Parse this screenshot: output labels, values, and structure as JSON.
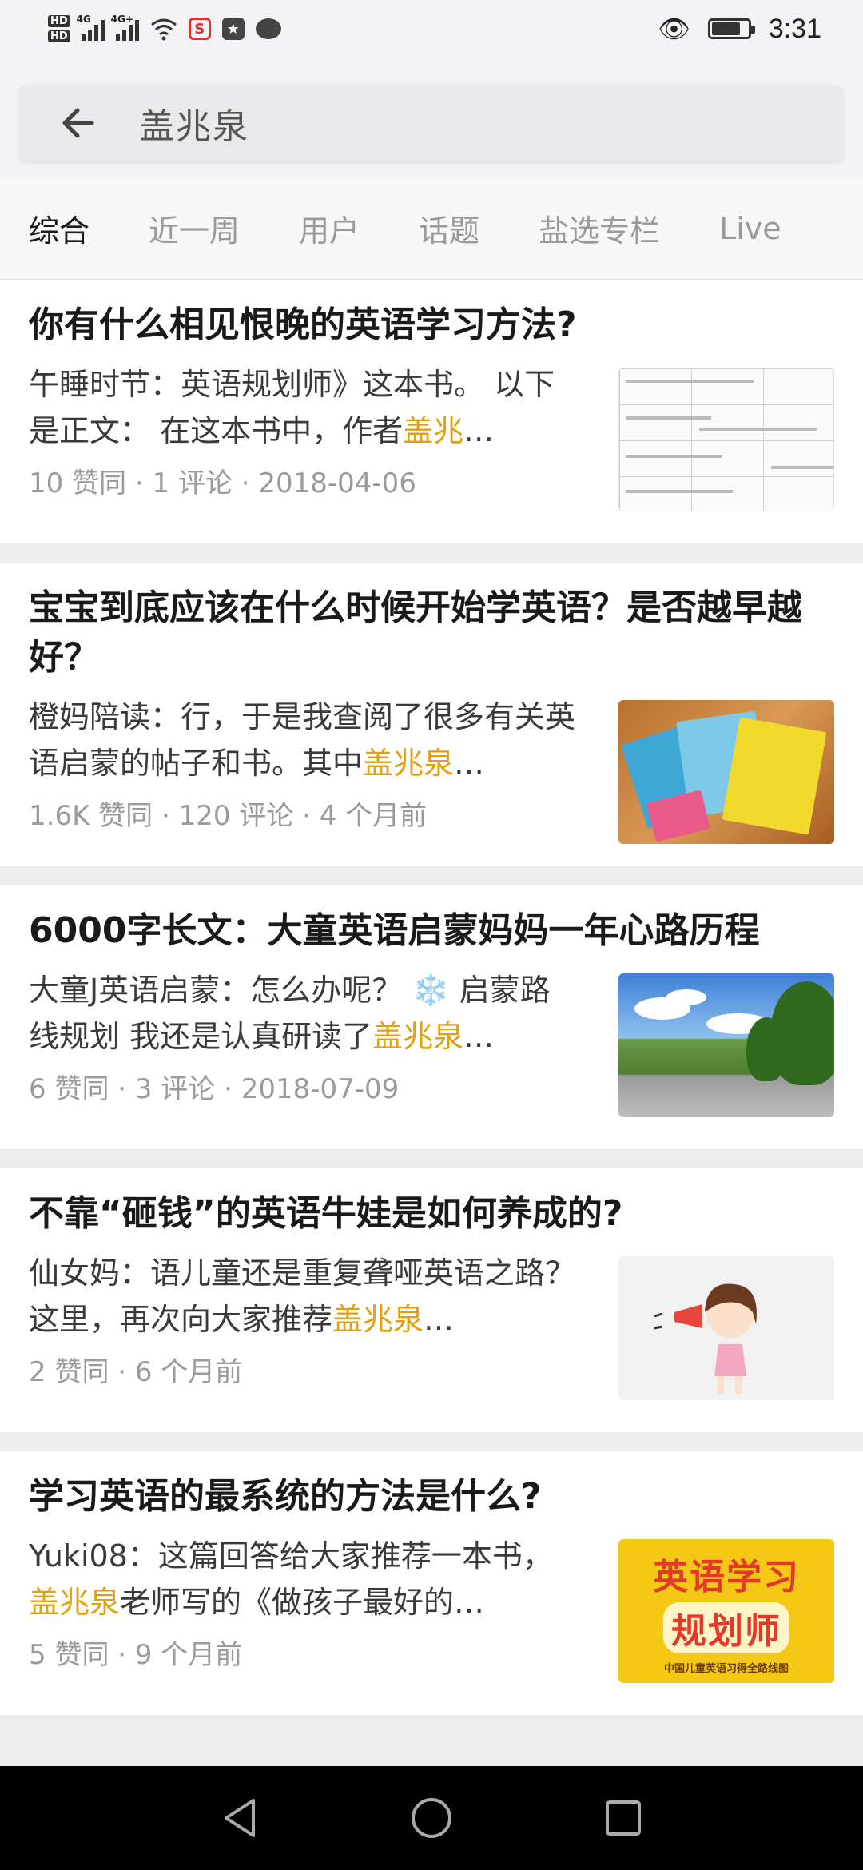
{
  "status_bar": {
    "hd_labels": [
      "HD",
      "HD"
    ],
    "signal_labels": [
      "4G",
      "4G+"
    ],
    "time": "3:31",
    "icons": [
      "wifi-icon",
      "app-notification-icon",
      "app-notification-icon",
      "chat-icon",
      "eye-comfort-icon",
      "battery-icon"
    ]
  },
  "search": {
    "query": "盖兆泉",
    "back_icon": "back-arrow-icon"
  },
  "tabs": [
    {
      "label": "综合",
      "active": true
    },
    {
      "label": "近一周",
      "active": false
    },
    {
      "label": "用户",
      "active": false
    },
    {
      "label": "话题",
      "active": false
    },
    {
      "label": "盐选专栏",
      "active": false
    },
    {
      "label": "Live",
      "active": false
    }
  ],
  "results": [
    {
      "title": "你有什么相见恨晚的英语学习方法?",
      "excerpt_before": "午睡时节：英语规划师》这本书。 以下是正文： 在这本书中，作者",
      "excerpt_highlight": "盖兆",
      "excerpt_after": "…",
      "meta": "10 赞同 · 1 评论 · 2018-04-06",
      "thumbnail": "document-table-image"
    },
    {
      "title": "宝宝到底应该在什么时候开始学英语？是否越早越好？",
      "excerpt_before": "橙妈陪读：行，于是我查阅了很多有关英语启蒙的帖子和书。其中",
      "excerpt_highlight": "盖兆泉",
      "excerpt_after": "…",
      "meta": "1.6K 赞同 · 120 评论 · 4 个月前",
      "thumbnail": "books-image"
    },
    {
      "title": "6000字长文：大童英语启蒙妈妈一年心路历程",
      "excerpt_before": "大童J英语启蒙：怎么办呢？ ❄️ 启蒙路线规划 我还是认真研读了",
      "excerpt_highlight": "盖兆泉",
      "excerpt_after": "…",
      "meta": "6 赞同 · 3 评论 · 2018-07-09",
      "thumbnail": "road-landscape-image"
    },
    {
      "title": "不靠“砸钱”的英语牛娃是如何养成的?",
      "excerpt_before": "仙女妈：语儿童还是重复聋哑英语之路？ 这里，再次向大家推荐",
      "excerpt_highlight": "盖兆泉",
      "excerpt_after": "…",
      "meta": "2 赞同 · 6 个月前",
      "thumbnail": "cartoon-girl-megaphone-image"
    },
    {
      "title": "学习英语的最系统的方法是什么?",
      "excerpt_before": "Yuki08：这篇回答给大家推荐一本书，",
      "excerpt_highlight": "盖兆泉",
      "excerpt_after": "老师写的《做孩子最好的…",
      "meta": "5 赞同 · 9 个月前",
      "thumbnail": "book-cover-poster-image",
      "poster": {
        "line1": "英语学习",
        "line2": "规划师",
        "line3": "中国儿童英语习得全路线图"
      }
    }
  ],
  "colors": {
    "highlight": "#e0a010",
    "meta": "#9b9b9b",
    "background": "#ededee"
  },
  "navbar": {
    "icons": [
      "back-triangle-icon",
      "home-circle-icon",
      "recents-square-icon"
    ]
  }
}
